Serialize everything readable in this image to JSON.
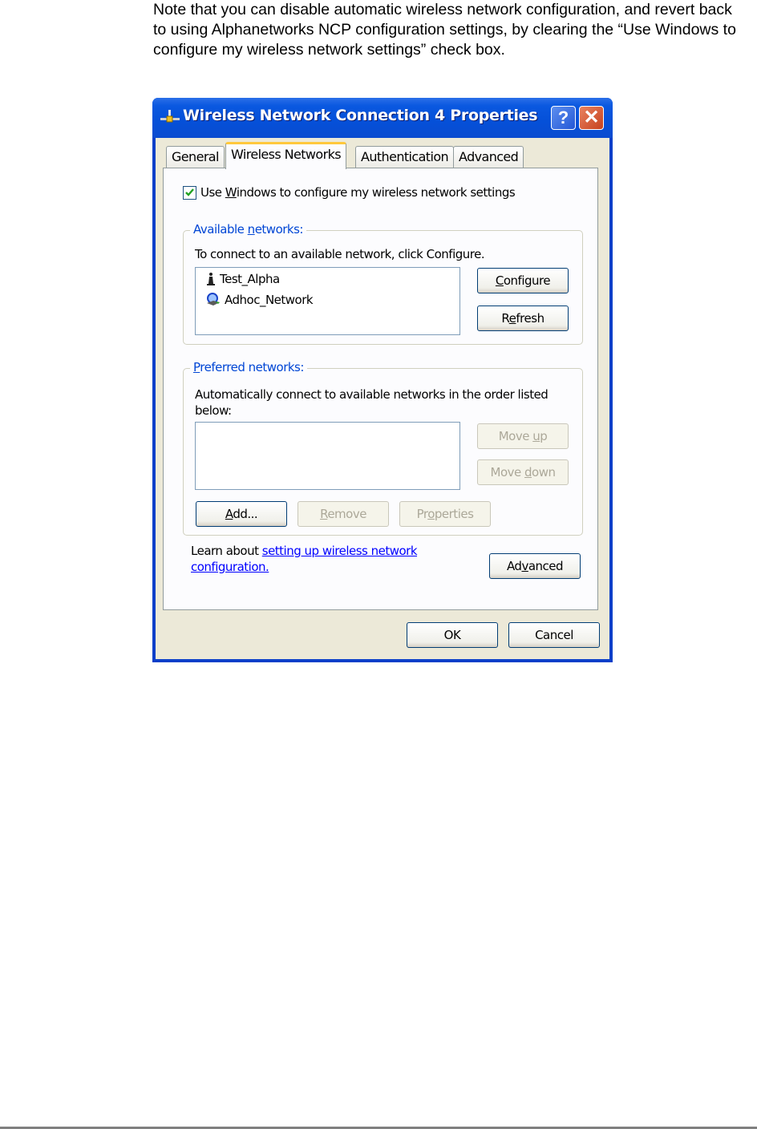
{
  "document": {
    "note_text": "Note that you can disable automatic wireless network configuration, and revert back to using Alphanetworks NCP configuration settings, by clearing the “Use Windows to configure my wireless network settings” check box."
  },
  "dialog": {
    "title": "Wireless Network Connection 4 Properties",
    "title_icon": "network-connection-icon",
    "help_label": "?",
    "close_label": "✕",
    "tabs": [
      {
        "label": "General",
        "active": false
      },
      {
        "label": "Wireless Networks",
        "active": true
      },
      {
        "label": "Authentication",
        "active": false
      },
      {
        "label": "Advanced",
        "active": false
      }
    ],
    "use_windows_checkbox": {
      "checked": true,
      "label_pre": "Use ",
      "label_u": "W",
      "label_post": "indows to configure my wireless network settings"
    },
    "available": {
      "title_pre": "Available ",
      "title_u": "n",
      "title_post": "etworks:",
      "description": "To connect to an available network, click Configure.",
      "networks": [
        {
          "name": "Test_Alpha",
          "icon": "access-point-icon"
        },
        {
          "name": "Adhoc_Network",
          "icon": "adhoc-network-icon"
        }
      ],
      "configure": {
        "u": "C",
        "rest": "onfigure"
      },
      "refresh": {
        "pre": "R",
        "u": "e",
        "rest": "fresh"
      }
    },
    "preferred": {
      "title_u": "P",
      "title_post": "referred networks:",
      "description": "Automatically connect to available networks in the order listed below:",
      "networks": [],
      "move_up": {
        "pre": "Move ",
        "u": "u",
        "rest": "p"
      },
      "move_down": {
        "pre": "Move ",
        "u": "d",
        "rest": "own"
      },
      "add": {
        "u": "A",
        "rest": "dd..."
      },
      "remove": {
        "u": "R",
        "rest": "emove"
      },
      "properties": {
        "pre": "Pr",
        "u": "o",
        "rest": "perties"
      }
    },
    "learn": {
      "prefix": "Learn about ",
      "link": "setting up wireless network configuration."
    },
    "advanced_button": {
      "pre": "Ad",
      "u": "v",
      "rest": "anced"
    },
    "ok_label": "OK",
    "cancel_label": "Cancel"
  },
  "colors": {
    "title_bar": "#0550d8",
    "group_title": "#0046d5",
    "active_tab_accent": "#ffc83c",
    "link": "#0000ff"
  }
}
